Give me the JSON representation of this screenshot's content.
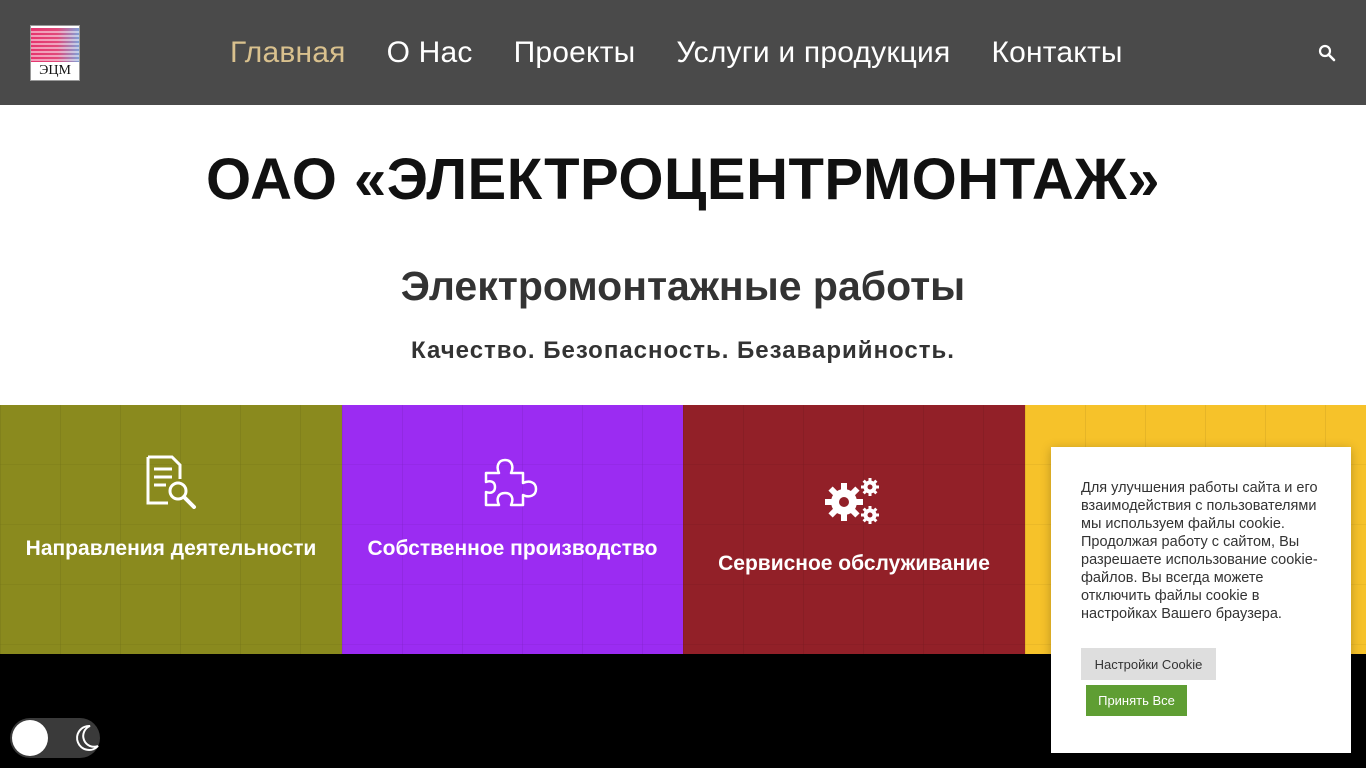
{
  "header": {
    "logo_text": "ЭЦМ",
    "nav": [
      {
        "label": "Главная",
        "active": true
      },
      {
        "label": "О Нас",
        "active": false
      },
      {
        "label": "Проекты",
        "active": false
      },
      {
        "label": "Услуги и продукция",
        "active": false
      },
      {
        "label": "Контакты",
        "active": false
      }
    ],
    "search_icon": "search-icon",
    "colors": {
      "background": "#4a4a4a",
      "active_link": "#d9c18e",
      "link": "#ffffff"
    }
  },
  "hero": {
    "title": "ОАО «ЭЛЕКТРОЦЕНТРМОНТАЖ»",
    "subtitle": "Электромонтажные работы",
    "tagline": "Качество. Безопасность. Безаварийность."
  },
  "tiles": [
    {
      "label": "Направления деятельности",
      "icon": "document-search-icon",
      "color": "#8a8a1e"
    },
    {
      "label": "Собственное производство",
      "icon": "puzzle-icon",
      "color": "#9b2cf2"
    },
    {
      "label": "Сервисное обслуживание",
      "icon": "gears-icon",
      "color": "#922028"
    },
    {
      "label": "",
      "icon": "",
      "color": "#f6c22a"
    }
  ],
  "theme_toggle": {
    "icon": "moon-icon"
  },
  "cookie": {
    "text": "Для улучшения работы сайта и его взаимодействия с пользователями мы используем файлы cookie. Продолжая работу с сайтом, Вы разрешаете использование cookie-файлов. Вы всегда можете отключить файлы cookie в настройках Вашего браузера.",
    "settings_label": "Настройки Cookie",
    "accept_label": "Принять Все",
    "accept_color": "#5f9e33"
  }
}
